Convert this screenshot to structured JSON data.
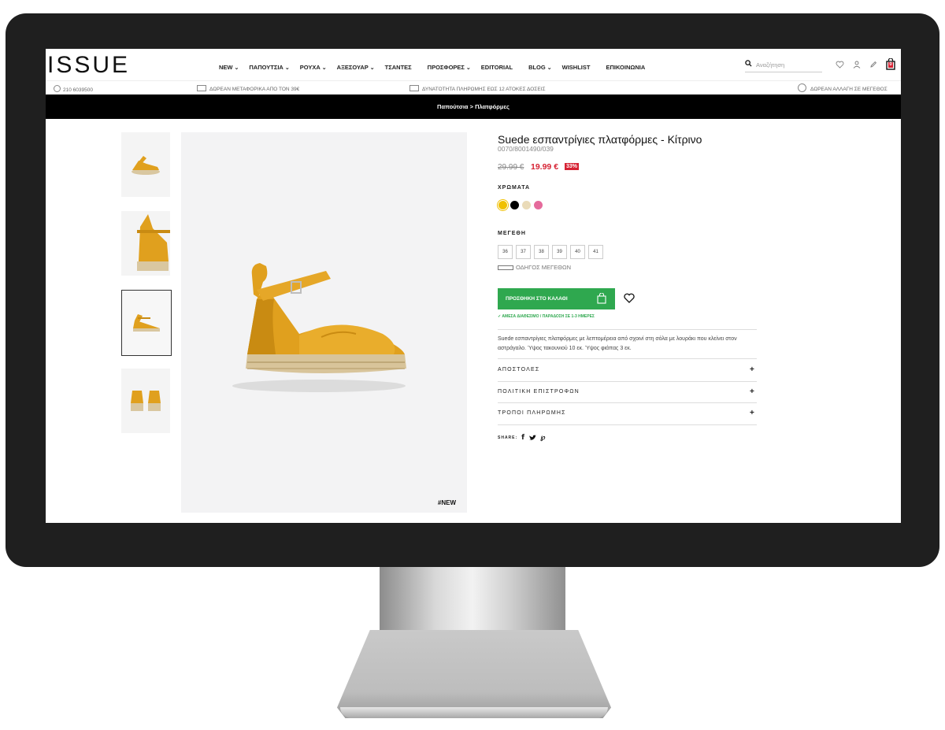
{
  "header": {
    "logo": "ISSUE",
    "nav": [
      {
        "label": "NEW",
        "dropdown": true
      },
      {
        "label": "ΠΑΠΟΥΤΣΙΑ",
        "dropdown": true
      },
      {
        "label": "ΡΟΥΧΑ",
        "dropdown": true
      },
      {
        "label": "ΑΞΕΣΟΥΑΡ",
        "dropdown": true
      },
      {
        "label": "ΤΣΑΝΤΕΣ",
        "dropdown": false
      },
      {
        "label": "ΠΡΟΣΦΟΡΕΣ",
        "dropdown": true
      },
      {
        "label": "EDITORIAL",
        "dropdown": false
      },
      {
        "label": "BLOG",
        "dropdown": true
      },
      {
        "label": "WISHLIST",
        "dropdown": false
      },
      {
        "label": "ΕΠΙΚΟΙΝΩΝΙΑ",
        "dropdown": false
      }
    ],
    "search_placeholder": "Αναζήτηση",
    "cart_count": "0",
    "icons": [
      "heart-icon",
      "user-icon",
      "pencil-icon",
      "bag-icon"
    ]
  },
  "topbar": {
    "phone": "210 6039500",
    "shipping": "ΔΩΡΕΑΝ ΜΕΤΑΦΟΡΙΚΑ ΑΠΟ ΤΟΝ 39€",
    "installments": "ΔΥΝΑΤΟΤΗΤΑ ΠΛΗΡΩΜΗΣ ΕΩΣ 12 ΑΤΟΚΕΣ ΔΟΣΕΙΣ",
    "exchange": "ΔΩΡΕΑΝ ΑΛΛΑΓΗ ΣΕ ΜΕΓΕΘΟΣ"
  },
  "breadcrumb": "Παπούτσια > Πλατφόρμες",
  "gallery": {
    "tag": "#NEW"
  },
  "product": {
    "title": "Suede εσπαντρίγιες πλατφόρμες - Κίτρινο",
    "sku": "0070/8001490/039",
    "price_old": "29.99 €",
    "price_new": "19.99 €",
    "discount": "33%",
    "colors_label": "ΧΡΩΜΑΤΑ",
    "colors": [
      "#f0c000",
      "#000000",
      "#eadbb8",
      "#e56b9c"
    ],
    "sizes_label": "ΜΕΓΕΘΗ",
    "sizes": [
      "36",
      "37",
      "38",
      "39",
      "40",
      "41"
    ],
    "size_guide": "ΟΔΗΓΟΣ ΜΕΓΕΘΩΝ",
    "add_to_cart": "ΠΡΟΣΘΗΚΗ ΣΤΟ ΚΑΛΑΘΙ",
    "availability": "ΑΜΕΣΑ ΔΙΑΘΕΣΙΜΟ / ΠΑΡΑΔΟΣΗ ΣΕ 1-3 ΗΜΕΡΕΣ",
    "description": "Suede εσπαντρίγιες πλατφόρμες με λεπτομέρεια από σχοινί στη σόλα με λουράκι που κλείνει στον αστράγαλο. Ύψος τακουνιού 10 εκ. Ύψος φιάπας 3 εκ.",
    "accordions": [
      "ΑΠΟΣΤΟΛΕΣ",
      "ΠΟΛΙΤΙΚΗ ΕΠΙΣΤΡΟΦΩΝ",
      "ΤΡΟΠΟΙ ΠΛΗΡΩΜΗΣ"
    ],
    "share_label": "SHARE:"
  },
  "colors": {
    "accent_green": "#2fa84f",
    "sale_red": "#d62233",
    "shoe_mustard": "#e0a01e"
  }
}
